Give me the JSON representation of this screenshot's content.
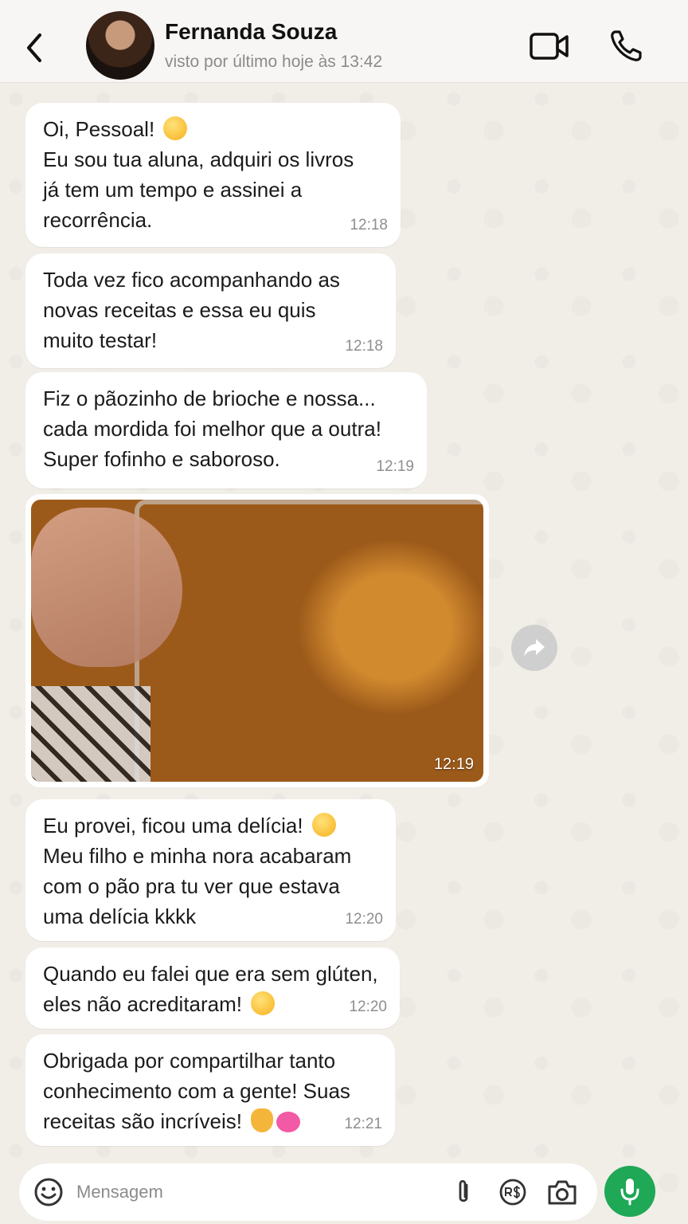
{
  "header": {
    "contact_name": "Fernanda Souza",
    "status": "visto por último hoje às 13:42"
  },
  "messages": [
    {
      "text": "Oi, Pessoal! ",
      "text2": "Eu sou tua aluna, adquiri os livros\njá tem um tempo e assinei a\nrecorrência.",
      "emoji": "smiling-face",
      "time": "12:18"
    },
    {
      "text": "Toda vez fico acompanhando as\nnovas receitas e essa eu quis\nmuito testar!",
      "time": "12:18"
    },
    {
      "text": "Fiz o pãozinho de brioche e nossa...\ncada mordida foi melhor que a outra!\nSuper fofinho e saboroso.",
      "time": "12:19"
    },
    {
      "type": "image",
      "description_icon": "brioche-bread-photo",
      "time": "12:19"
    },
    {
      "text": "Eu provei, ficou uma delícia! ",
      "text2": "Meu filho e minha nora acabaram\ncom o pão pra tu ver que estava\numa delícia kkkk",
      "emoji": "yum-face",
      "time": "12:20"
    },
    {
      "text": "Quando eu falei que era sem glúten,\neles não acreditaram! ",
      "emoji": "laughing-face",
      "time": "12:20"
    },
    {
      "text": "Obrigada por compartilhar tanto\nconhecimento com a gente! Suas\nreceitas são incríveis! ",
      "emoji": "clap-hearts",
      "time": "12:21"
    }
  ],
  "input": {
    "placeholder": "Mensagem"
  },
  "icons": {
    "back": "chevron-left-icon",
    "video": "video-camera-icon",
    "call": "phone-icon",
    "forward": "forward-icon",
    "emoji": "emoji-icon",
    "attach": "paperclip-icon",
    "payment": "pix-payment-icon",
    "camera": "camera-icon",
    "mic": "microphone-icon"
  },
  "colors": {
    "accent_green": "#1fa855",
    "bubble_bg": "#ffffff",
    "chat_bg": "#f1ede7"
  }
}
